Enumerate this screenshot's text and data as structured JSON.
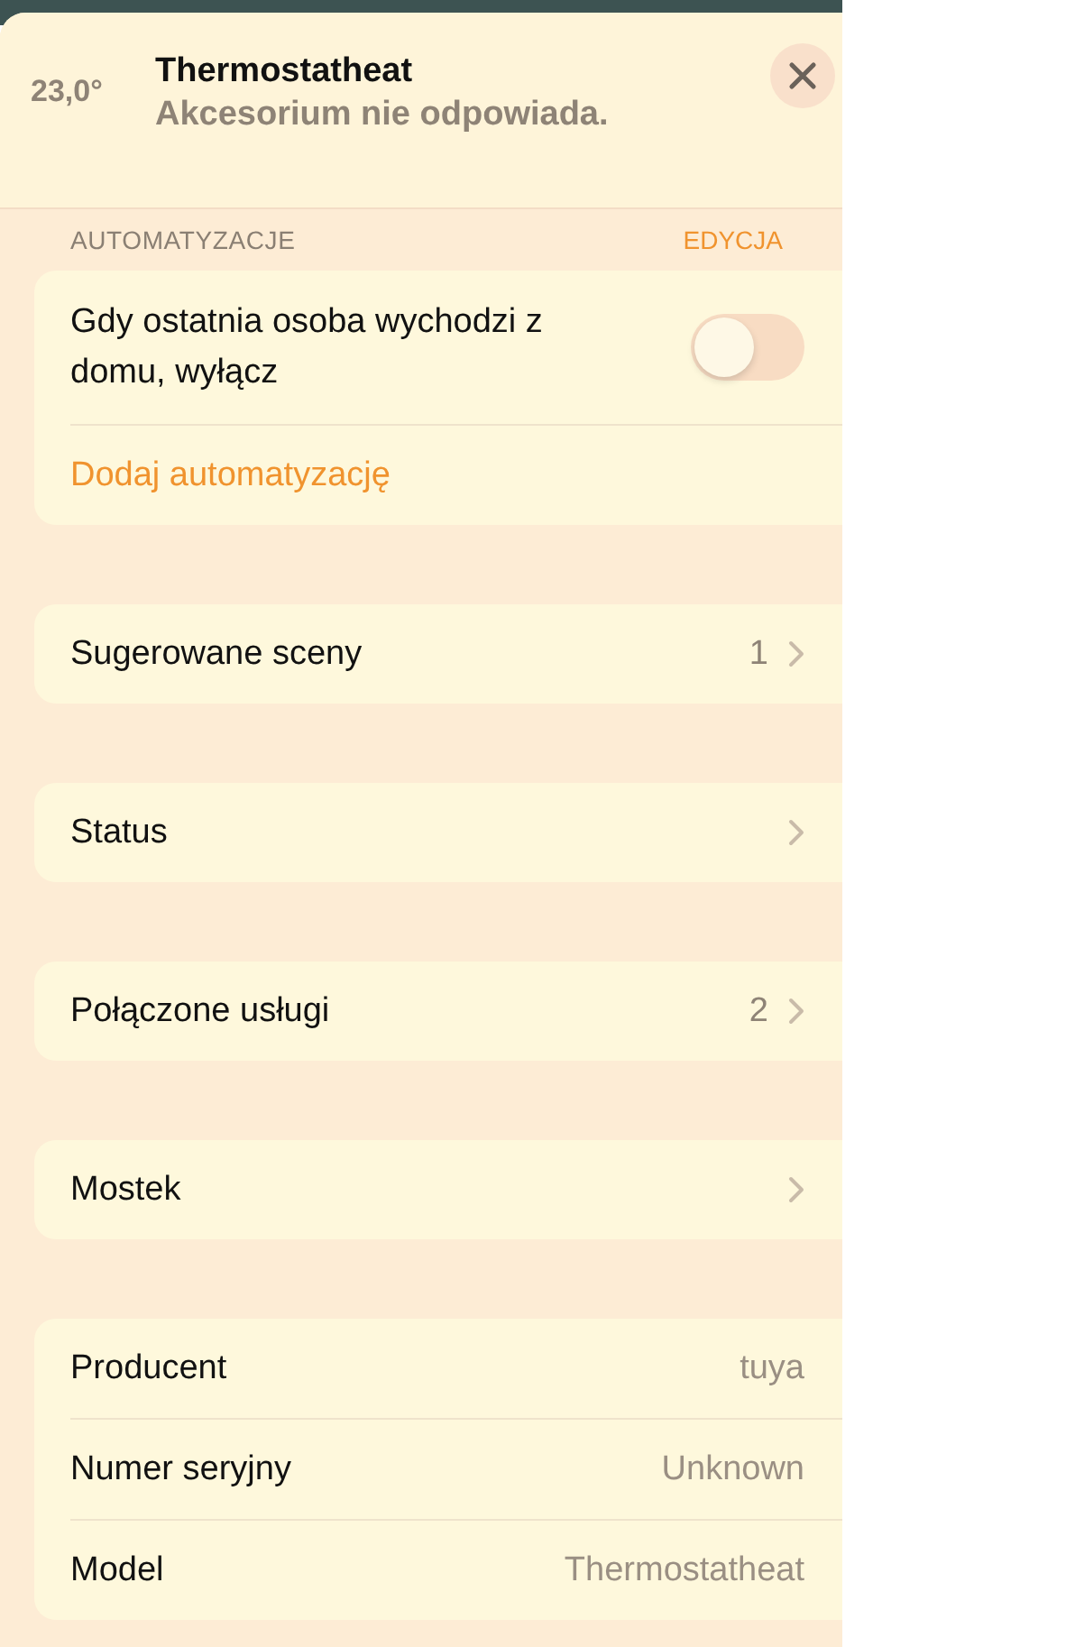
{
  "header": {
    "temperature": "23,0°",
    "title": "Thermostatheat",
    "subtitle": "Akcesorium nie odpowiada."
  },
  "automations": {
    "title": "AUTOMATYZACJE",
    "action": "EDYCJA",
    "items": [
      {
        "label": "Gdy ostatnia osoba wychodzi z domu, wyłącz",
        "on": false
      }
    ],
    "add_link": "Dodaj automatyzację"
  },
  "nav_groups": [
    [
      {
        "label": "Sugerowane sceny",
        "value": "1"
      }
    ],
    [
      {
        "label": "Status"
      }
    ],
    [
      {
        "label": "Połączone usługi",
        "value": "2"
      }
    ],
    [
      {
        "label": "Mostek"
      }
    ]
  ],
  "info": [
    {
      "label": "Producent",
      "value": "tuya"
    },
    {
      "label": "Numer seryjny",
      "value": "Unknown"
    },
    {
      "label": "Model",
      "value": "Thermostatheat"
    }
  ]
}
